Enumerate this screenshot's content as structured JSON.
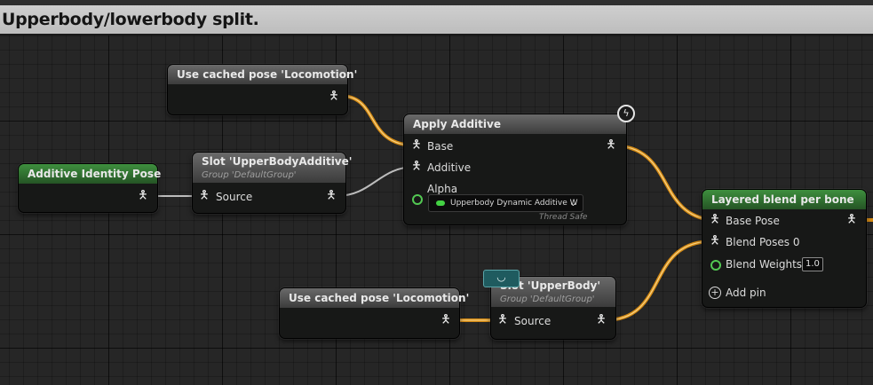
{
  "comment": {
    "title": "Upperbody/lowerbody split."
  },
  "nodes": {
    "cached_top": {
      "title": "Use cached pose 'Locomotion'"
    },
    "cached_bottom": {
      "title": "Use cached pose 'Locomotion'"
    },
    "identity": {
      "title": "Additive Identity Pose"
    },
    "slot_additive": {
      "title": "Slot 'UpperBodyAdditive'",
      "group": "Group 'DefaultGroup'",
      "source_label": "Source"
    },
    "slot_upper": {
      "title": "Slot 'UpperBody'",
      "group": "Group 'DefaultGroup'",
      "source_label": "Source"
    },
    "apply_additive": {
      "title": "Apply Additive",
      "base_label": "Base",
      "additive_label": "Additive",
      "alpha_label": "Alpha",
      "alpha_dropdown": "Upperbody Dynamic Additive W",
      "thread_safe": "Thread Safe"
    },
    "layered_blend": {
      "title": "Layered blend per bone",
      "base_pose_label": "Base Pose",
      "blend_poses_label": "Blend Poses 0",
      "blend_weights_label": "Blend Weights 0",
      "blend_weights_value": "1.0",
      "add_pin_label": "Add pin"
    }
  },
  "icons": {
    "pose_pin": "pose-person-icon",
    "alpha_pin": "float-ring-icon",
    "fast_path": "lightning-icon",
    "add_pin": "plus-circle-icon",
    "dropdown": "chevron-down-icon",
    "comment_bubble": "speech-bubble-icon"
  },
  "colors": {
    "pose_wire": "#f0a020",
    "alpha_pin": "#52c852",
    "apply_header": "#5a5a5a",
    "green_header": "#2f6b2f",
    "comment_bar": "#c8c8c8"
  }
}
